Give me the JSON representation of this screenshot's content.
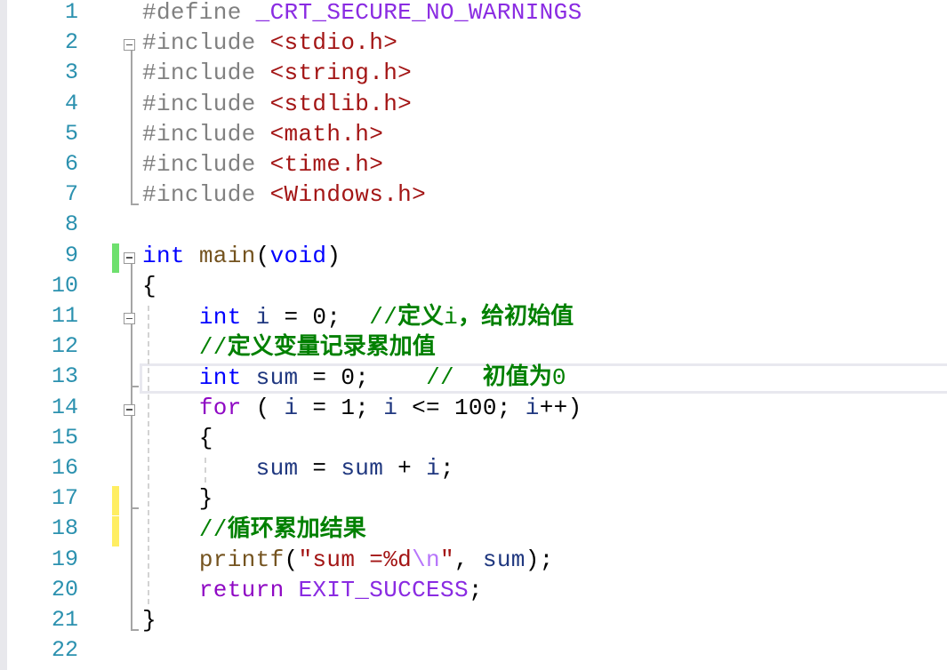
{
  "editor": {
    "current_line": 13,
    "lines": [
      {
        "n": "1",
        "tokens": [
          [
            "pp",
            "#define "
          ],
          [
            "macro",
            "_CRT_SECURE_NO_WARNINGS"
          ]
        ]
      },
      {
        "n": "2",
        "tokens": [
          [
            "pp",
            "#include "
          ],
          [
            "hdr",
            "<stdio.h>"
          ]
        ]
      },
      {
        "n": "3",
        "tokens": [
          [
            "pp",
            "#include "
          ],
          [
            "hdr",
            "<string.h>"
          ]
        ]
      },
      {
        "n": "4",
        "tokens": [
          [
            "pp",
            "#include "
          ],
          [
            "hdr",
            "<stdlib.h>"
          ]
        ]
      },
      {
        "n": "5",
        "tokens": [
          [
            "pp",
            "#include "
          ],
          [
            "hdr",
            "<math.h>"
          ]
        ]
      },
      {
        "n": "6",
        "tokens": [
          [
            "pp",
            "#include "
          ],
          [
            "hdr",
            "<time.h>"
          ]
        ]
      },
      {
        "n": "7",
        "tokens": [
          [
            "pp",
            "#include "
          ],
          [
            "hdr",
            "<Windows.h>"
          ]
        ]
      },
      {
        "n": "8",
        "tokens": []
      },
      {
        "n": "9",
        "tokens": [
          [
            "kw",
            "int"
          ],
          [
            "punc",
            " "
          ],
          [
            "fn",
            "main"
          ],
          [
            "punc",
            "("
          ],
          [
            "kw",
            "void"
          ],
          [
            "punc",
            ")"
          ]
        ]
      },
      {
        "n": "10",
        "tokens": [
          [
            "punc",
            "{"
          ]
        ]
      },
      {
        "n": "11",
        "tokens": [
          [
            "punc",
            "    "
          ],
          [
            "kw",
            "int"
          ],
          [
            "punc",
            " "
          ],
          [
            "var",
            "i"
          ],
          [
            "punc",
            " = 0;  "
          ],
          [
            "cmt",
            "//"
          ],
          [
            "cmtcjk",
            "定义"
          ],
          [
            "cmt",
            "i"
          ],
          [
            "cmtcjk",
            "，给初始值"
          ]
        ]
      },
      {
        "n": "12",
        "tokens": [
          [
            "punc",
            "    "
          ],
          [
            "cmt",
            "//"
          ],
          [
            "cmtcjk",
            "定义变量记录累加值"
          ]
        ]
      },
      {
        "n": "13",
        "tokens": [
          [
            "punc",
            "    "
          ],
          [
            "kw",
            "int"
          ],
          [
            "punc",
            " "
          ],
          [
            "var",
            "sum"
          ],
          [
            "punc",
            " = 0;    "
          ],
          [
            "cmt",
            "//  "
          ],
          [
            "cmtcjk",
            "初值为"
          ],
          [
            "cmt",
            "0"
          ]
        ]
      },
      {
        "n": "14",
        "tokens": [
          [
            "punc",
            "    "
          ],
          [
            "ctrl",
            "for"
          ],
          [
            "punc",
            " ( "
          ],
          [
            "var",
            "i"
          ],
          [
            "punc",
            " = 1; "
          ],
          [
            "var",
            "i"
          ],
          [
            "punc",
            " <= 100; "
          ],
          [
            "var",
            "i"
          ],
          [
            "punc",
            "++)"
          ]
        ]
      },
      {
        "n": "15",
        "tokens": [
          [
            "punc",
            "    {"
          ]
        ]
      },
      {
        "n": "16",
        "tokens": [
          [
            "punc",
            "        "
          ],
          [
            "var",
            "sum"
          ],
          [
            "punc",
            " = "
          ],
          [
            "var",
            "sum"
          ],
          [
            "punc",
            " + "
          ],
          [
            "var",
            "i"
          ],
          [
            "punc",
            ";"
          ]
        ]
      },
      {
        "n": "17",
        "tokens": [
          [
            "punc",
            "    }"
          ]
        ]
      },
      {
        "n": "18",
        "tokens": [
          [
            "punc",
            "    "
          ],
          [
            "cmt",
            "//"
          ],
          [
            "cmtcjk",
            "循环累加结果"
          ]
        ]
      },
      {
        "n": "19",
        "tokens": [
          [
            "punc",
            "    "
          ],
          [
            "fn",
            "printf"
          ],
          [
            "punc",
            "("
          ],
          [
            "str",
            "\"sum =%d"
          ],
          [
            "esc",
            "\\n"
          ],
          [
            "str",
            "\""
          ],
          [
            "punc",
            ", "
          ],
          [
            "var",
            "sum"
          ],
          [
            "punc",
            ");"
          ]
        ]
      },
      {
        "n": "20",
        "tokens": [
          [
            "punc",
            "    "
          ],
          [
            "ctrl",
            "return"
          ],
          [
            "punc",
            " "
          ],
          [
            "macro",
            "EXIT_SUCCESS"
          ],
          [
            "punc",
            ";"
          ]
        ]
      },
      {
        "n": "21",
        "tokens": [
          [
            "punc",
            "}"
          ]
        ]
      },
      {
        "n": "22",
        "tokens": []
      }
    ],
    "change_markers": [
      {
        "line": 9,
        "status": "saved",
        "color": "#6ee06e"
      },
      {
        "line": 17,
        "status": "unsaved",
        "color": "#ffee62"
      },
      {
        "line": 18,
        "status": "unsaved",
        "color": "#ffee62"
      }
    ],
    "fold_regions": [
      {
        "start": 2,
        "end": 7
      },
      {
        "start": 9,
        "end": 21
      },
      {
        "start": 11,
        "end": 13
      },
      {
        "start": 14,
        "end": 17
      }
    ]
  }
}
